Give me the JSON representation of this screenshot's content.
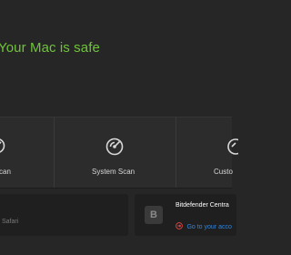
{
  "status": {
    "message": "Your Mac is safe",
    "color": "#6fc43a"
  },
  "scans": [
    {
      "label": "Quick Scan",
      "visible_text": "can",
      "icon": "quick-scan-icon"
    },
    {
      "label": "System Scan",
      "visible_text": "System Scan",
      "icon": "system-scan-icon"
    },
    {
      "label": "Custom Scan",
      "visible_text": "Custo",
      "icon": "custom-scan-icon"
    }
  ],
  "cards": {
    "safari": {
      "subtitle": "Safari"
    },
    "central": {
      "icon_letter": "B",
      "title": "Bitdefender Centra",
      "link": "Go to your acco",
      "link_color": "#2f86e0"
    }
  }
}
